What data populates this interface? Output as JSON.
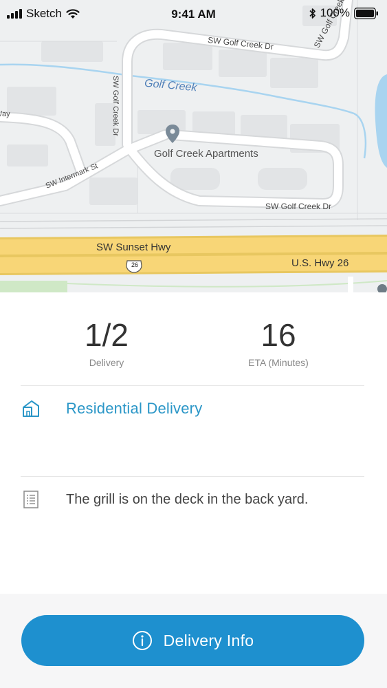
{
  "status_bar": {
    "carrier": "Sketch",
    "time": "9:41 AM",
    "battery_percent": "100%"
  },
  "map": {
    "labels": {
      "golf_creek_dr_top": "SW Golf Creek Dr",
      "golf_creek_dr_right": "SW Golf Creek Dr",
      "golf_creek_dr_vertical": "SW Golf Creek Dr",
      "golf_creek": "Golf Creek",
      "way_fragment": "/ay",
      "intermark_st": "SW Intermark St",
      "poi_name": "Golf Creek Apartments",
      "golf_creek_dr_bottom": "SW Golf Creek Dr",
      "sunset_hwy": "SW Sunset Hwy",
      "shield_number": "26",
      "us_hwy": "U.S. Hwy 26"
    }
  },
  "summary": {
    "delivery_count": {
      "value": "1/2",
      "label": "Delivery"
    },
    "eta": {
      "value": "16",
      "label": "ETA (Minutes)"
    }
  },
  "delivery": {
    "type_label": "Residential Delivery",
    "type_icon": "house-icon",
    "note": "The grill is on the deck in the back yard.",
    "note_icon": "document-list-icon"
  },
  "actions": {
    "delivery_info_label": "Delivery Info",
    "delivery_info_icon": "info-icon"
  },
  "colors": {
    "accent": "#2a96c7",
    "button": "#1e90cf",
    "highway": "#f8d677",
    "water": "#a8d4f0",
    "map_bg": "#eef0f1"
  }
}
